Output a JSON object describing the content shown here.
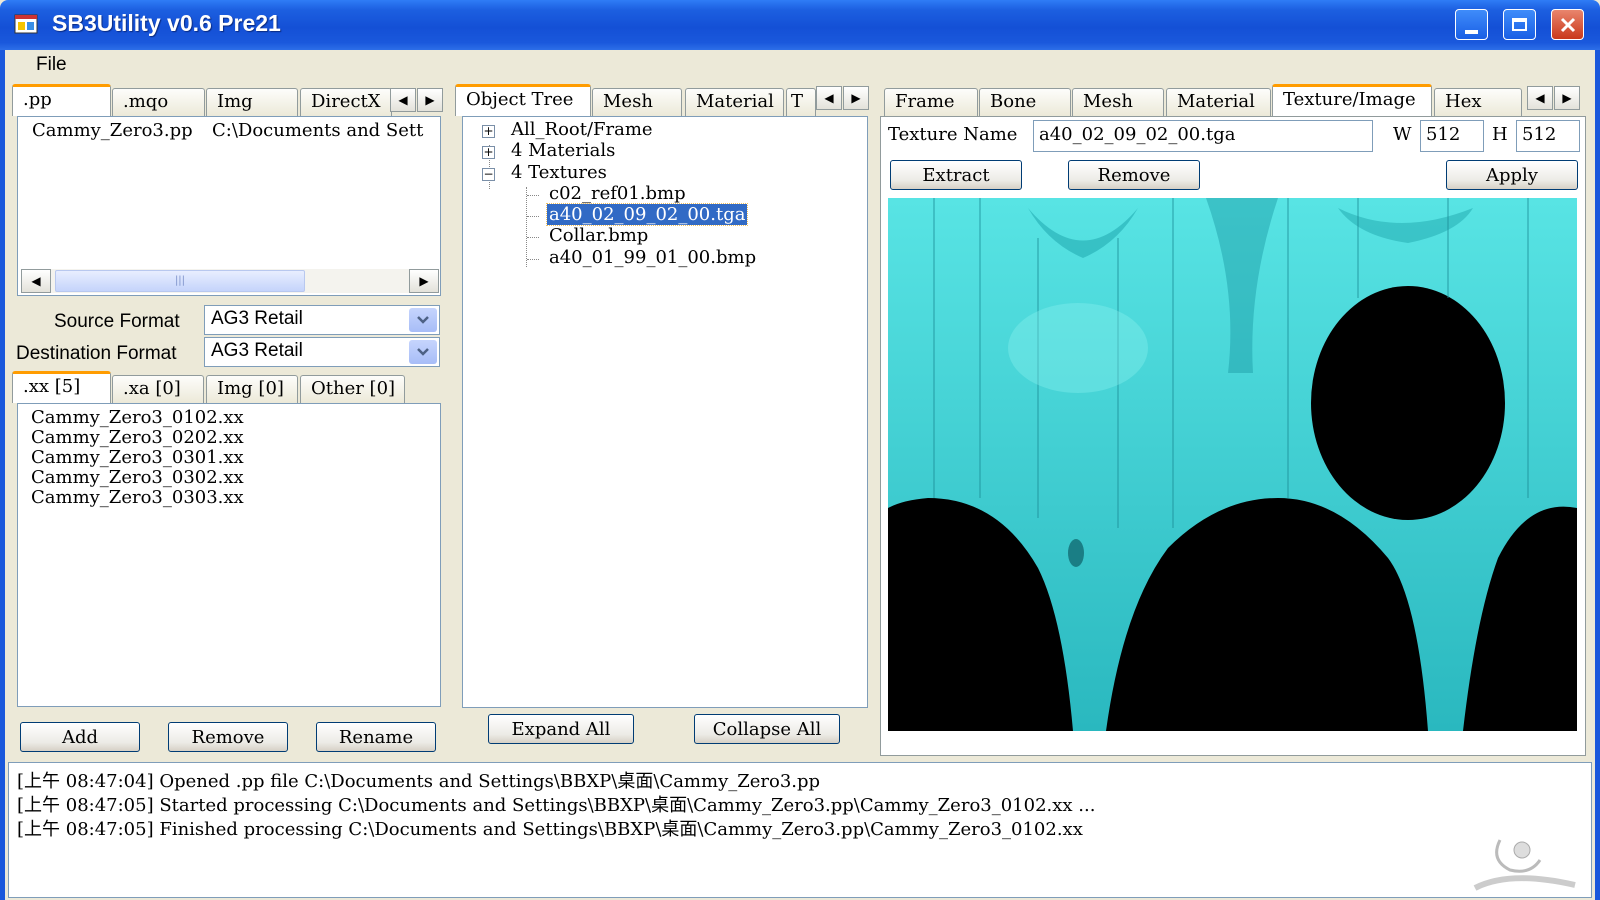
{
  "window": {
    "title": "SB3Utility v0.6 Pre21"
  },
  "menu": {
    "file": "File"
  },
  "left": {
    "tabs": [
      ".pp",
      ".mqo",
      "Img",
      "DirectX"
    ],
    "pp_file": {
      "name": "Cammy_Zero3.pp",
      "path": "C:\\Documents and Sett"
    },
    "source_format_label": "Source Format",
    "source_format_value": "AG3 Retail",
    "destination_format_label": "Destination Format",
    "destination_format_value": "AG3 Retail",
    "sub_tabs": [
      ".xx [5]",
      ".xa [0]",
      "Img [0]",
      "Other [0]"
    ],
    "xx_files": [
      "Cammy_Zero3_0102.xx",
      "Cammy_Zero3_0202.xx",
      "Cammy_Zero3_0301.xx",
      "Cammy_Zero3_0302.xx",
      "Cammy_Zero3_0303.xx"
    ],
    "buttons": {
      "add": "Add",
      "remove": "Remove",
      "rename": "Rename"
    }
  },
  "middle": {
    "tabs": [
      "Object Tree",
      "Mesh",
      "Material",
      "T"
    ],
    "tree": {
      "root": "All_Root/Frame",
      "materials": "4 Materials",
      "textures": "4 Textures",
      "texture_items": [
        "c02_ref01.bmp",
        "a40_02_09_02_00.tga",
        "Collar.bmp",
        "a40_01_99_01_00.bmp"
      ]
    },
    "buttons": {
      "expand_all": "Expand All",
      "collapse_all": "Collapse All"
    }
  },
  "right": {
    "tabs": [
      "Frame",
      "Bone",
      "Mesh",
      "Material",
      "Texture/Image",
      "Hex"
    ],
    "texture_name_label": "Texture Name",
    "texture_name_value": "a40_02_09_02_00.tga",
    "w_label": "W",
    "w_value": "512",
    "h_label": "H",
    "h_value": "512",
    "buttons": {
      "extract": "Extract",
      "remove": "Remove",
      "apply": "Apply"
    }
  },
  "log": [
    "[上午 08:47:04] Opened .pp file C:\\Documents and Settings\\BBXP\\桌面\\Cammy_Zero3.pp",
    "[上午 08:47:05] Started processing C:\\Documents and Settings\\BBXP\\桌面\\Cammy_Zero3.pp\\Cammy_Zero3_0102.xx ...",
    "[上午 08:47:05] Finished processing C:\\Documents and Settings\\BBXP\\桌面\\Cammy_Zero3.pp\\Cammy_Zero3_0102.xx"
  ],
  "colors": {
    "titlebar": "#1450d6",
    "selection": "#316ac5",
    "texture_cyan": "#3fd8d8",
    "tab_accent": "#ff9c00"
  }
}
